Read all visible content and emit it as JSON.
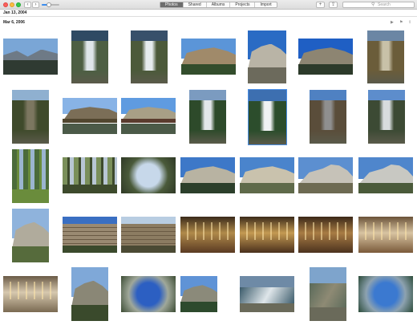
{
  "toolbar": {
    "tabs": [
      {
        "label": "Photos",
        "active": true
      },
      {
        "label": "Shared",
        "active": false
      },
      {
        "label": "Albums",
        "active": false
      },
      {
        "label": "Projects",
        "active": false
      },
      {
        "label": "Import",
        "active": false
      }
    ],
    "zoom_level": 0.4,
    "search_placeholder": "Search",
    "back_icon": "‹",
    "forward_icon": "›",
    "add_icon": "+",
    "share_icon": "⇪"
  },
  "section_headers": {
    "first": "Jan 13, 2004",
    "second": "Mar 6, 2006"
  },
  "header_icons": [
    "play-icon",
    "flag-icon",
    "share-icon"
  ],
  "header_glyphs": [
    "▶",
    "⚑",
    "⇪"
  ],
  "photos": [
    {
      "scene": "valley",
      "c": [
        "#7aa6d6",
        "#6e7a86",
        "#2f3a32"
      ]
    },
    {
      "scene": "waterfall",
      "c": [
        "#2f4a63",
        "#dfe6ea",
        "#4d5f43"
      ]
    },
    {
      "scene": "waterfall",
      "c": [
        "#38506a",
        "#e6ecee",
        "#4c5a3a"
      ]
    },
    {
      "scene": "cliff",
      "c": [
        "#5b95d8",
        "#a08a6a",
        "#334d2c"
      ]
    },
    {
      "scene": "cliff",
      "c": [
        "#2a6bc4",
        "#b9b4a6",
        "#6c6a5c"
      ]
    },
    {
      "scene": "cliff",
      "c": [
        "#1f5fc4",
        "#8d8572",
        "#2c3a2a"
      ]
    },
    {
      "scene": "waterfall",
      "c": [
        "#6b86a4",
        "#c8c1a8",
        "#6b5d3a"
      ]
    },
    {
      "scene": "waterfall",
      "c": [
        "#8fb0d0",
        "#7c7760",
        "#3f4a2b"
      ]
    },
    {
      "scene": "bridge",
      "c": [
        "#88b3e6",
        "#7b6e57",
        "#51462f"
      ]
    },
    {
      "scene": "bridge",
      "c": [
        "#5f9be0",
        "#a89f86",
        "#5a3b2e"
      ]
    },
    {
      "scene": "waterfall",
      "c": [
        "#7b9bc0",
        "#e3e7ea",
        "#2d4a2a"
      ]
    },
    {
      "scene": "waterfall",
      "c": [
        "#3d6fb0",
        "#f0f2f4",
        "#2c4d2c"
      ]
    },
    {
      "scene": "waterfall",
      "c": [
        "#4f81c2",
        "#8f8f8f",
        "#5a4d3a"
      ]
    },
    {
      "scene": "waterfall",
      "c": [
        "#5d8dcc",
        "#d8dcde",
        "#3c4a34"
      ]
    },
    {
      "scene": "forest",
      "c": [
        "#9bb5cf",
        "#4b6b3a",
        "#6a8c3c"
      ]
    },
    {
      "scene": "forest",
      "c": [
        "#b8c6d4",
        "#7a8f5a",
        "#3d4a2c"
      ]
    },
    {
      "scene": "trees-up",
      "c": [
        "#c7d8ea",
        "#4a5a3a",
        "#2f3926"
      ]
    },
    {
      "scene": "cliff",
      "c": [
        "#3d78c8",
        "#b8b3a2",
        "#2c3f2b"
      ]
    },
    {
      "scene": "cliff",
      "c": [
        "#4a84cc",
        "#c9c2ad",
        "#5f6a4a"
      ]
    },
    {
      "scene": "dome",
      "c": [
        "#5c8fd0",
        "#c6c2b8",
        "#6d6a52"
      ]
    },
    {
      "scene": "dome",
      "c": [
        "#4f86cc",
        "#c8c8c2",
        "#4a5a3a"
      ]
    },
    {
      "scene": "cliff",
      "c": [
        "#8fb3dc",
        "#b0ab9c",
        "#566b3c"
      ]
    },
    {
      "scene": "hotel",
      "c": [
        "#3a6fc2",
        "#9a8a72",
        "#3b4a2c"
      ]
    },
    {
      "scene": "hotel",
      "c": [
        "#b8cde2",
        "#8c7c62",
        "#4b4a34"
      ]
    },
    {
      "scene": "hall",
      "c": [
        "#3a2a1a",
        "#b08a4a",
        "#5a3a22"
      ]
    },
    {
      "scene": "hall",
      "c": [
        "#3b2a1a",
        "#c49a52",
        "#4a301c"
      ]
    },
    {
      "scene": "hall",
      "c": [
        "#3a2818",
        "#a87c44",
        "#4c321e"
      ]
    },
    {
      "scene": "hall",
      "c": [
        "#6a5238",
        "#d8c4a2",
        "#7a5a3a"
      ]
    },
    {
      "scene": "hall",
      "c": [
        "#6a5a46",
        "#d6c8ae",
        "#7a6a52"
      ]
    },
    {
      "scene": "cliff",
      "c": [
        "#7fa8d8",
        "#8a8776",
        "#3a4a2c"
      ]
    },
    {
      "scene": "trees-up",
      "c": [
        "#2c5fc2",
        "#a0a89a",
        "#3c4c34"
      ]
    },
    {
      "scene": "cliff",
      "c": [
        "#5f93d6",
        "#8b8a7a",
        "#2d4a2d"
      ]
    },
    {
      "scene": "river",
      "c": [
        "#6e8aa6",
        "#dfe6ea",
        "#3a5a6a"
      ]
    },
    {
      "scene": "river",
      "c": [
        "#7ea4cc",
        "#8e8a74",
        "#5a6a5a"
      ]
    },
    {
      "scene": "trees-up",
      "c": [
        "#3b79d0",
        "#8da2b0",
        "#2c4c3a"
      ]
    }
  ]
}
